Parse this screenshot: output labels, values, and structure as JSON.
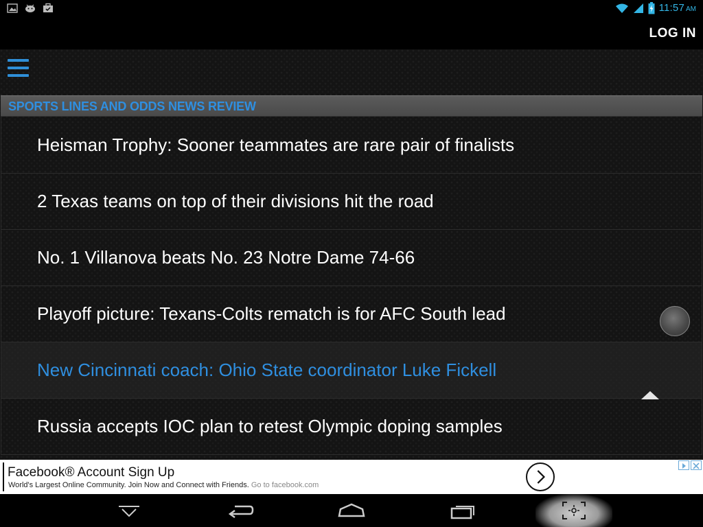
{
  "status_bar": {
    "left_icons": [
      "image-icon",
      "android-icon",
      "briefcase-icon"
    ],
    "right_icons": [
      "wifi-icon",
      "signal-icon",
      "battery-charging-icon"
    ],
    "time": "11:57",
    "ampm": "AM"
  },
  "action_bar": {
    "login_label": "LOG IN"
  },
  "main": {
    "menu_icon": "hamburger-menu-icon",
    "section_header": "SPORTS LINES AND ODDS NEWS REVIEW",
    "news_items": [
      {
        "title": "Heisman Trophy: Sooner teammates are rare pair of finalists",
        "active": false
      },
      {
        "title": "2 Texas teams on top of their divisions hit the road",
        "active": false
      },
      {
        "title": "No. 1 Villanova beats No. 23 Notre Dame 74-66",
        "active": false
      },
      {
        "title": "Playoff picture: Texans-Colts rematch is for AFC South lead",
        "active": false
      },
      {
        "title": "New Cincinnati coach: Ohio State coordinator Luke Fickell",
        "active": true
      },
      {
        "title": "Russia accepts IOC plan to retest Olympic doping samples",
        "active": false
      }
    ]
  },
  "ad": {
    "title": "Facebook® Account Sign Up",
    "description": "World's Largest Online Community. Join Now and Connect with Friends.",
    "link": "Go to facebook.com"
  },
  "nav_bar": {
    "buttons": [
      "hide-keyboard-icon",
      "back-icon",
      "home-icon",
      "recent-apps-icon",
      "screenshot-icon"
    ]
  },
  "colors": {
    "accent_blue": "#2f8fe0",
    "status_blue": "#33b5e5",
    "background": "#141414",
    "header_gray": "#555555"
  }
}
